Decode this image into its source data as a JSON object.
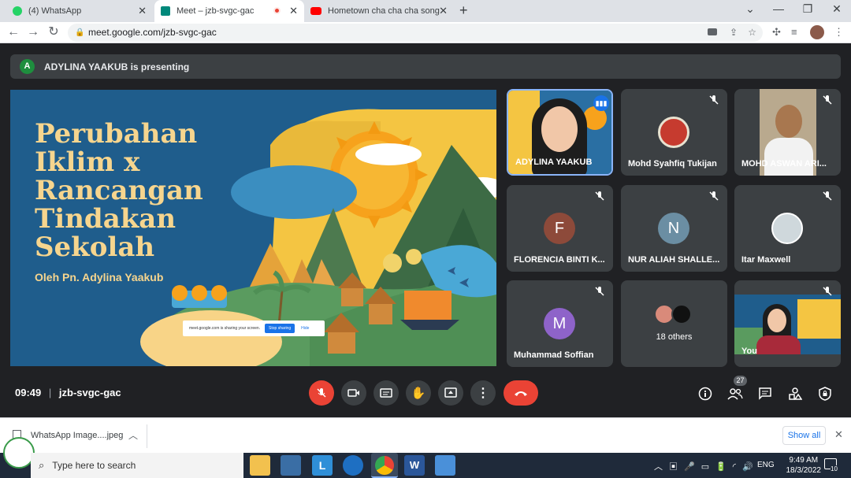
{
  "browser": {
    "tabs": [
      {
        "label": "(4) WhatsApp",
        "active": false,
        "icon": "whatsapp-icon",
        "color": "#25d366"
      },
      {
        "label": "Meet – jzb-svgc-gac",
        "active": true,
        "icon": "meet-icon",
        "color": "#00897b"
      },
      {
        "label": "Hometown cha cha cha song | H",
        "active": false,
        "icon": "youtube-icon",
        "color": "#ff0000"
      }
    ],
    "url": "meet.google.com/jzb-svgc-gac"
  },
  "meet": {
    "presenting_initial": "A",
    "presenting_text": "ADYLINA YAAKUB is presenting",
    "slide": {
      "title_lines": [
        "Perubahan",
        "Iklim x",
        "Rancangan",
        "Tindakan",
        "Sekolah"
      ],
      "byline": "Oleh Pn. Adylina Yaakub",
      "share_notice": {
        "text": "meet.google.com is sharing your screen.",
        "stop": "Stop sharing",
        "hide": "Hide"
      }
    },
    "participants": [
      {
        "name": "ADYLINA YAAKUB",
        "type": "video",
        "speaking": true
      },
      {
        "name": "Mohd Syahfiq Tukijan",
        "type": "avatar",
        "muted": true
      },
      {
        "name": "MOHD ASWAN ARI...",
        "type": "video",
        "muted": true
      },
      {
        "name": "FLORENCIA BINTI K...",
        "type": "initial",
        "initial": "F",
        "color": "#8d4a3a",
        "muted": true
      },
      {
        "name": "NUR ALIAH SHALLE...",
        "type": "initial",
        "initial": "N",
        "color": "#6b8ea3",
        "muted": true
      },
      {
        "name": "Itar Maxwell",
        "type": "avatar",
        "muted": true
      },
      {
        "name": "Muhammad Soffian",
        "type": "initial",
        "initial": "M",
        "color": "#8e63c9",
        "muted": true
      },
      {
        "name": "18 others",
        "type": "others"
      },
      {
        "name": "You",
        "type": "video",
        "muted": true
      }
    ],
    "time": "09:49",
    "meeting_code": "jzb-svgc-gac",
    "people_count": "27"
  },
  "downloads": {
    "file": "WhatsApp Image....jpeg",
    "show_all": "Show all"
  },
  "taskbar": {
    "search_placeholder": "Type here to search",
    "language": "ENG",
    "time": "9:49 AM",
    "date": "18/3/2022",
    "notifications": "10"
  }
}
